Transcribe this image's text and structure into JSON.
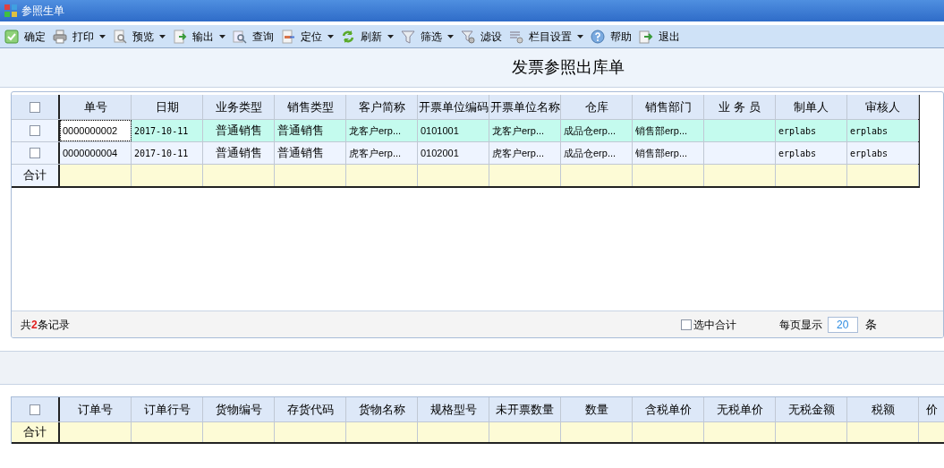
{
  "window": {
    "title": "参照生单"
  },
  "toolbar": [
    {
      "label": "确定",
      "dropdown": false
    },
    {
      "label": "打印",
      "dropdown": true
    },
    {
      "label": "预览",
      "dropdown": true
    },
    {
      "label": "输出",
      "dropdown": true
    },
    {
      "label": "查询",
      "dropdown": false
    },
    {
      "label": "定位",
      "dropdown": true
    },
    {
      "label": "刷新",
      "dropdown": true
    },
    {
      "label": "筛选",
      "dropdown": true
    },
    {
      "label": "滤设",
      "dropdown": false
    },
    {
      "label": "栏目设置",
      "dropdown": true
    },
    {
      "label": "帮助",
      "dropdown": false
    },
    {
      "label": "退出",
      "dropdown": false
    }
  ],
  "page_title": "发票参照出库单",
  "upper_table": {
    "header_checked": false,
    "columns": [
      "单号",
      "日期",
      "业务类型",
      "销售类型",
      "客户简称",
      "开票单位编码",
      "开票单位名称",
      "仓库",
      "销售部门",
      "业 务 员",
      "制单人",
      "审核人"
    ],
    "rows": [
      {
        "selected": true,
        "checked": false,
        "focused": true,
        "cells": [
          "0000000002",
          "2017-10-11",
          "普通销售",
          "普通销售",
          "龙客户erp...",
          "0101001",
          "龙客户erp...",
          "成品仓erp...",
          "销售部erp...",
          "",
          "erplabs",
          "erplabs"
        ]
      },
      {
        "selected": false,
        "checked": false,
        "focused": false,
        "cells": [
          "0000000004",
          "2017-10-11",
          "普通销售",
          "普通销售",
          "虎客户erp...",
          "0102001",
          "虎客户erp...",
          "成品仓erp...",
          "销售部erp...",
          "",
          "erplabs",
          "erplabs"
        ]
      }
    ],
    "total_label": "合计"
  },
  "footer": {
    "prefix": "共",
    "count": "2",
    "suffix": "条记录",
    "sum_selected": {
      "label": "选中合计",
      "checked": false
    },
    "page_size_label": "每页显示",
    "page_size": "20",
    "page_size_unit": "条"
  },
  "lower_table": {
    "header_checked": false,
    "columns": [
      "订单号",
      "订单行号",
      "货物编号",
      "存货代码",
      "货物名称",
      "规格型号",
      "未开票数量",
      "数量",
      "含税单价",
      "无税单价",
      "无税金额",
      "税额",
      "价"
    ],
    "total_label": "合计"
  }
}
